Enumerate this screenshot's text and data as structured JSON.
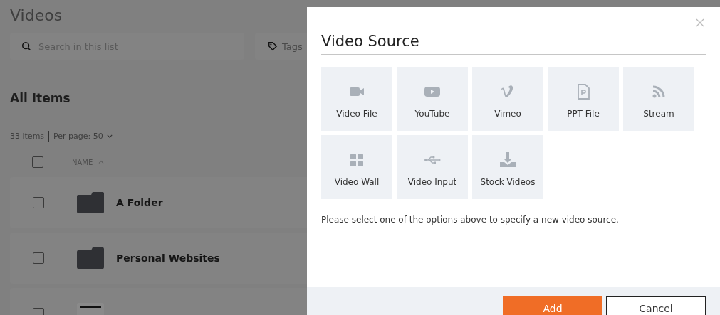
{
  "page": {
    "title": "Videos",
    "search": {
      "placeholder": "Search in this list"
    },
    "tags_label": "Tags",
    "section_title": "All Items",
    "item_count": "33 items",
    "per_page_label": "Per page:",
    "per_page_value": "50",
    "select_all_checked": false,
    "columns": [
      {
        "label": "NAME",
        "sort_ascending": true
      }
    ],
    "rows": [
      {
        "name": "A Folder",
        "kind": "folder",
        "checked": false
      },
      {
        "name": "Personal Websites",
        "kind": "folder",
        "checked": false
      },
      {
        "kind": "blank",
        "checked": false
      }
    ]
  },
  "dialog": {
    "title": "Video Source",
    "options": [
      {
        "label": "Video File",
        "kind": "camera"
      },
      {
        "label": "YouTube",
        "kind": "play"
      },
      {
        "label": "Vimeo",
        "kind": "vimeo"
      },
      {
        "label": "PPT File",
        "kind": "ppt"
      },
      {
        "label": "Stream",
        "kind": "rss"
      },
      {
        "label": "Video Wall",
        "kind": "grid"
      },
      {
        "label": "Video Input",
        "kind": "usb"
      },
      {
        "label": "Stock Videos",
        "kind": "download"
      }
    ],
    "message": "Please select one of the options above to specify a new video source.",
    "buttons": [
      {
        "label": "Add",
        "kind": "primary"
      },
      {
        "label": "Cancel",
        "kind": "secondary"
      }
    ]
  }
}
